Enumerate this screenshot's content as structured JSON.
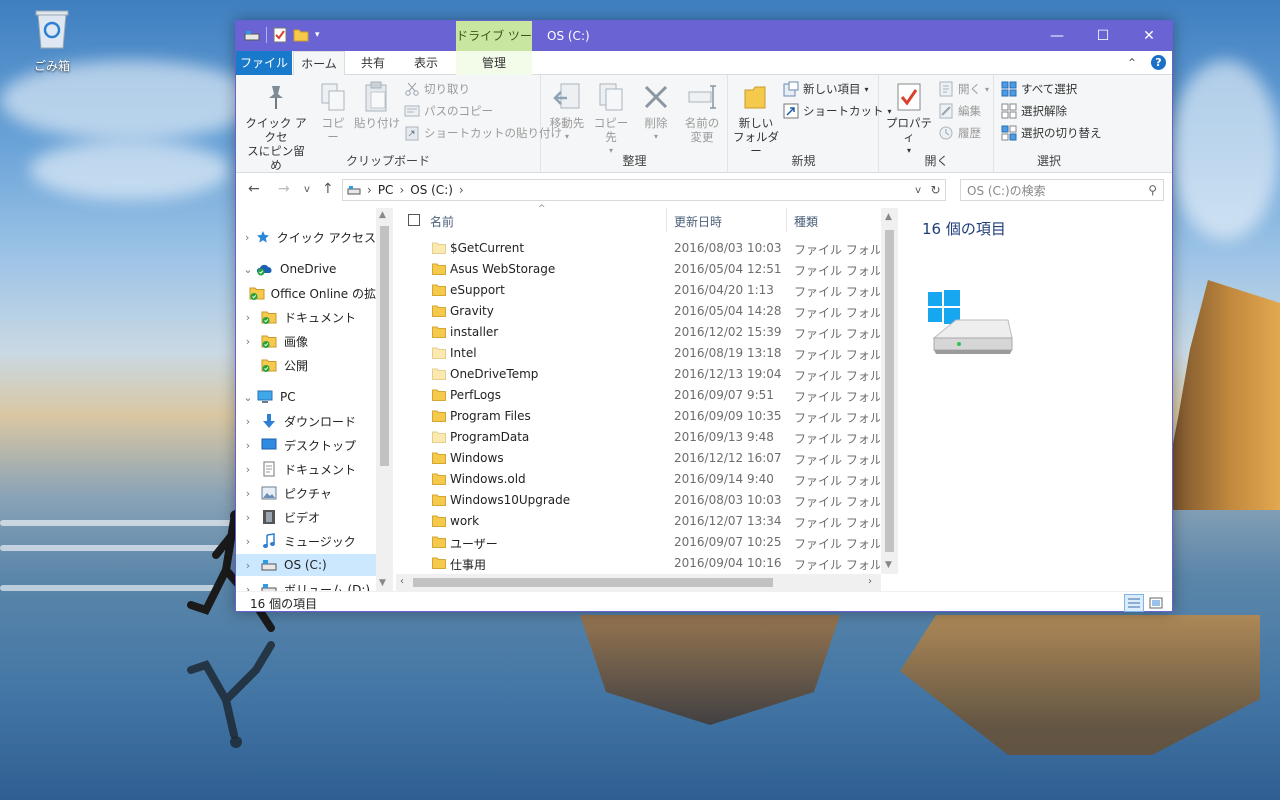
{
  "desktop": {
    "recycle_bin_label": "ごみ箱"
  },
  "window": {
    "title": "OS (C:)",
    "context_tab": "ドライブ ツール",
    "controls": {
      "minimize": "—",
      "maximize": "☐",
      "close": "✕"
    }
  },
  "tabs": {
    "file": "ファイル",
    "home": "ホーム",
    "share": "共有",
    "view": "表示",
    "manage": "管理",
    "collapse": "⌃",
    "help": "?"
  },
  "ribbon": {
    "clipboard": {
      "label": "クリップボード",
      "pin_line1": "クイック アクセ",
      "pin_line2": "スにピン留め",
      "copy": "コピー",
      "paste": "貼り付け",
      "cut": "切り取り",
      "copy_path": "パスのコピー",
      "paste_shortcut": "ショートカットの貼り付け"
    },
    "organize": {
      "label": "整理",
      "move_to": "移動先",
      "copy_to": "コピー先",
      "delete": "削除",
      "rename_line1": "名前の",
      "rename_line2": "変更"
    },
    "new": {
      "label": "新規",
      "new_folder_line1": "新しい",
      "new_folder_line2": "フォルダー",
      "new_item": "新しい項目",
      "shortcut": "ショートカット"
    },
    "open": {
      "label": "開く",
      "properties": "プロパティ",
      "open": "開く",
      "edit": "編集",
      "history": "履歴"
    },
    "select": {
      "label": "選択",
      "select_all": "すべて選択",
      "select_none": "選択解除",
      "invert": "選択の切り替え"
    }
  },
  "address": {
    "path": [
      "PC",
      "OS (C:)"
    ],
    "search_placeholder": "OS (C:)の検索"
  },
  "nav": {
    "items": [
      {
        "label": "クイック アクセス",
        "icon": "star-icon",
        "chev": ">",
        "indent": 0
      },
      {
        "label": "OneDrive",
        "icon": "onedrive-icon",
        "chev": "v",
        "indent": 0
      },
      {
        "label": "Office Online の拡",
        "icon": "synced-folder-icon",
        "chev": "",
        "indent": 1
      },
      {
        "label": "ドキュメント",
        "icon": "synced-folder-icon",
        "chev": ">",
        "indent": 1
      },
      {
        "label": "画像",
        "icon": "synced-folder-icon",
        "chev": ">",
        "indent": 1
      },
      {
        "label": "公開",
        "icon": "synced-folder-icon",
        "chev": "",
        "indent": 1
      },
      {
        "label": "PC",
        "icon": "pc-icon",
        "chev": "v",
        "indent": 0
      },
      {
        "label": "ダウンロード",
        "icon": "download-icon",
        "chev": ">",
        "indent": 1
      },
      {
        "label": "デスクトップ",
        "icon": "desktop-icon",
        "chev": ">",
        "indent": 1
      },
      {
        "label": "ドキュメント",
        "icon": "document-icon",
        "chev": ">",
        "indent": 1
      },
      {
        "label": "ピクチャ",
        "icon": "pictures-icon",
        "chev": ">",
        "indent": 1
      },
      {
        "label": "ビデオ",
        "icon": "video-icon",
        "chev": ">",
        "indent": 1
      },
      {
        "label": "ミュージック",
        "icon": "music-icon",
        "chev": ">",
        "indent": 1
      },
      {
        "label": "OS (C:)",
        "icon": "drive-icon",
        "chev": ">",
        "indent": 1,
        "selected": true
      },
      {
        "label": "ボリューム (D:)",
        "icon": "drive-icon",
        "chev": ">",
        "indent": 1
      }
    ]
  },
  "columns": {
    "name": "名前",
    "modified": "更新日時",
    "type": "種類"
  },
  "files": [
    {
      "name": "$GetCurrent",
      "date": "2016/08/03 10:03",
      "type": "ファイル フォルダー",
      "pale": true
    },
    {
      "name": "Asus WebStorage",
      "date": "2016/05/04 12:51",
      "type": "ファイル フォルダー",
      "pale": false
    },
    {
      "name": "eSupport",
      "date": "2016/04/20 1:13",
      "type": "ファイル フォルダー",
      "pale": false
    },
    {
      "name": "Gravity",
      "date": "2016/05/04 14:28",
      "type": "ファイル フォルダー",
      "pale": false
    },
    {
      "name": "installer",
      "date": "2016/12/02 15:39",
      "type": "ファイル フォルダー",
      "pale": false
    },
    {
      "name": "Intel",
      "date": "2016/08/19 13:18",
      "type": "ファイル フォルダー",
      "pale": true
    },
    {
      "name": "OneDriveTemp",
      "date": "2016/12/13 19:04",
      "type": "ファイル フォルダー",
      "pale": true
    },
    {
      "name": "PerfLogs",
      "date": "2016/09/07 9:51",
      "type": "ファイル フォルダー",
      "pale": false
    },
    {
      "name": "Program Files",
      "date": "2016/09/09 10:35",
      "type": "ファイル フォルダー",
      "pale": false
    },
    {
      "name": "ProgramData",
      "date": "2016/09/13 9:48",
      "type": "ファイル フォルダー",
      "pale": true
    },
    {
      "name": "Windows",
      "date": "2016/12/12 16:07",
      "type": "ファイル フォルダー",
      "pale": false
    },
    {
      "name": "Windows.old",
      "date": "2016/09/14 9:40",
      "type": "ファイル フォルダー",
      "pale": false
    },
    {
      "name": "Windows10Upgrade",
      "date": "2016/08/03 10:03",
      "type": "ファイル フォルダー",
      "pale": false
    },
    {
      "name": "work",
      "date": "2016/12/07 13:34",
      "type": "ファイル フォルダー",
      "pale": false
    },
    {
      "name": "ユーザー",
      "date": "2016/09/07 10:25",
      "type": "ファイル フォルダー",
      "pale": false
    },
    {
      "name": "仕事用",
      "date": "2016/09/04 10:16",
      "type": "ファイル フォルダー",
      "pale": false
    }
  ],
  "details": {
    "count": "16 個の項目"
  },
  "status": {
    "count": "16 個の項目"
  },
  "colors": {
    "titlebar": "#6a63d4",
    "file_tab": "#1979ca",
    "context_tab": "#c9e6a0",
    "selection": "#cce8ff",
    "folder": "#f5c94c"
  }
}
